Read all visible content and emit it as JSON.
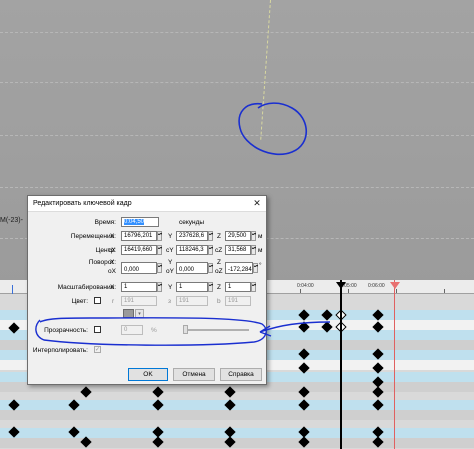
{
  "viewport": {
    "edge_label": "M(-23)-"
  },
  "timeline": {
    "ruler_labels": [
      "0:04:00",
      "0:05:00",
      "0:06:00"
    ]
  },
  "dialog": {
    "title": "Редактировать ключевой кадр",
    "close_icon": "close-icon",
    "time": {
      "label": "Время:",
      "value": "0:04,50",
      "unit": "секунды"
    },
    "move": {
      "label": "Перемещение:",
      "x_label": "X",
      "x_value": "16796,201",
      "y_label": "Y",
      "y_value": "237628,6",
      "z_label": "Z",
      "z_value": "29,500",
      "unit": "м"
    },
    "center": {
      "label": "Центр:",
      "x_label": "cX",
      "x_value": "16419,660",
      "y_label": "cY",
      "y_value": "118246,3",
      "z_label": "cZ",
      "z_value": "31,568",
      "unit": "м"
    },
    "rotate": {
      "label": "Поворот:",
      "x_label": "X",
      "y_label": "Y",
      "z_label": "Z",
      "x2_label": "oX",
      "x_value": "0,000",
      "y2_label": "oY",
      "y_value": "0,000",
      "z2_label": "oZ",
      "z_value": "-172,284",
      "unit": "°"
    },
    "scale": {
      "label": "Масштабирование:",
      "x_label": "X",
      "x_value": "1",
      "y_label": "Y",
      "y_value": "1",
      "z_label": "Z",
      "z_value": "1"
    },
    "color": {
      "label": "Цвет:",
      "r_label": "r",
      "r_value": "191",
      "g_label": "з",
      "g_value": "191",
      "b_label": "b",
      "b_value": "191"
    },
    "opacity": {
      "label": "Прозрачность:",
      "value": "0",
      "unit": "%"
    },
    "interpolate": {
      "label": "Интерполировать:",
      "checked": "✓"
    },
    "buttons": {
      "ok": "OK",
      "cancel": "Отмена",
      "help": "Справка"
    }
  }
}
